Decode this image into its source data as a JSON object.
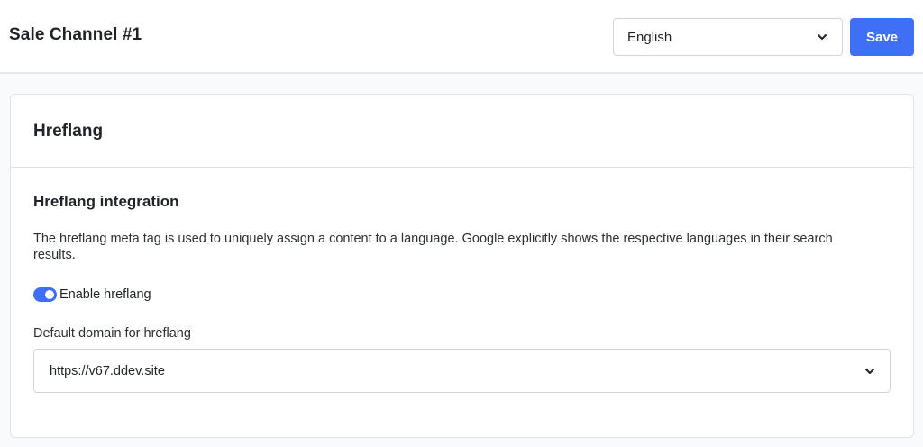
{
  "header": {
    "title": "Sale Channel #1",
    "language_select": {
      "value": "English",
      "icon": "chevron-down-icon"
    },
    "save_label": "Save"
  },
  "colors": {
    "accent": "#3e6ff4",
    "border": "#dfe3e8",
    "background": "#f9fafc"
  },
  "card": {
    "title": "Hreflang",
    "section_title": "Hreflang integration",
    "description": "The hreflang meta tag is used to uniquely assign a content to a language. Google explicitly shows the respective languages in their search results.",
    "toggle": {
      "label": "Enable hreflang",
      "checked": true
    },
    "domain_field": {
      "label": "Default domain for hreflang",
      "value": "https://v67.ddev.site",
      "icon": "chevron-down-icon"
    }
  }
}
